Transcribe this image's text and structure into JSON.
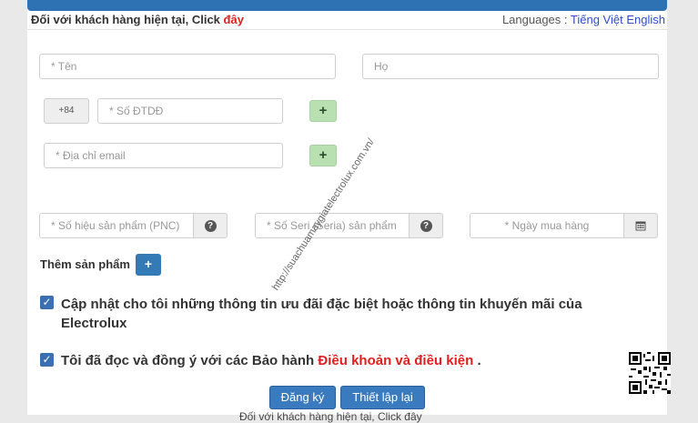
{
  "header": {
    "existing_prefix": "Đối với khách hàng hiện tại, Click",
    "existing_link": "đây",
    "languages_label": "Languages :",
    "lang_vi": "Tiếng Việt",
    "lang_en": "English"
  },
  "form": {
    "first_name_placeholder": "* Tên",
    "last_name_placeholder": "Họ",
    "country_code": "+84",
    "phone_placeholder": "* Số ĐTDĐ",
    "email_placeholder": "* Địa chỉ email",
    "add_label": "+",
    "pnc_placeholder": "* Số hiệu sản phẩm (PNC)",
    "serial_placeholder": "* Số Seri (Seria) sản phẩm",
    "date_placeholder": "* Ngày mua hàng",
    "add_product_label": "Thêm sản phẩm",
    "add_product_btn": "+",
    "newsletter_text": "Cập nhật cho tôi những thông tin ưu đãi đặc biệt hoặc thông tin khuyến mãi của Electrolux",
    "terms_prefix": "Tôi đã đọc và đồng ý với các Bảo hành",
    "terms_link": "Điều khoản và điều kiện",
    "terms_suffix": ".",
    "register_btn": "Đăng ký",
    "reset_btn": "Thiết lập lại"
  },
  "watermark": "http://suachuamaygiatelectrolux.com.vn/",
  "bottom_partial": "Đối với khách hàng hiện tại, Click đây",
  "colors": {
    "primary": "#337ab7",
    "link_red": "#e02020",
    "green_button": "#b9e0b1"
  },
  "icons": {
    "help": "question-circle-icon",
    "calendar": "calendar-icon",
    "checkbox": "checkmark-icon"
  }
}
